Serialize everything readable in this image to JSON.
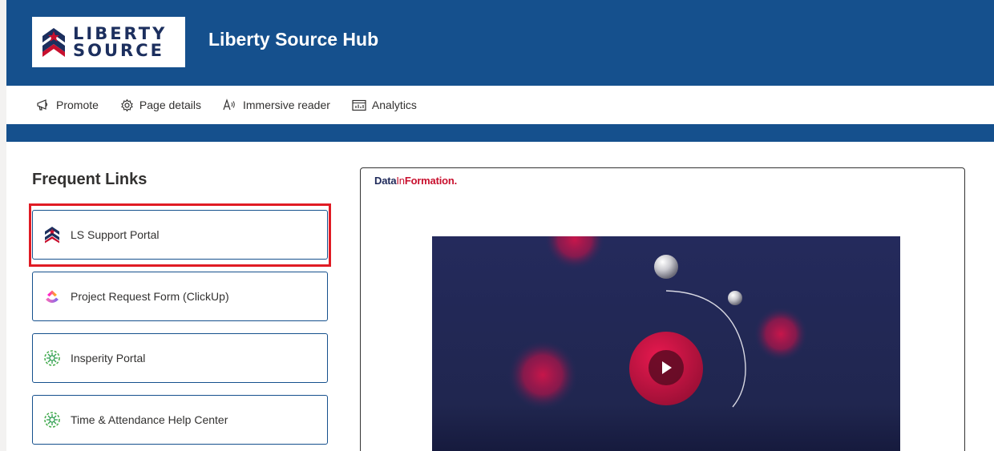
{
  "header": {
    "logo_line1": "LIBERTY",
    "logo_line2": "SOURCE",
    "site_title": "Liberty Source Hub"
  },
  "command_bar": {
    "items": [
      {
        "label": "Promote",
        "icon": "megaphone-icon"
      },
      {
        "label": "Page details",
        "icon": "gear-icon"
      },
      {
        "label": "Immersive reader",
        "icon": "immersive-reader-icon"
      },
      {
        "label": "Analytics",
        "icon": "analytics-icon"
      }
    ]
  },
  "frequent_links": {
    "title": "Frequent Links",
    "items": [
      {
        "label": "LS Support Portal",
        "icon": "liberty-source-icon",
        "highlighted": true
      },
      {
        "label": "Project Request Form (ClickUp)",
        "icon": "clickup-icon"
      },
      {
        "label": "Insperity Portal",
        "icon": "insperity-icon"
      },
      {
        "label": "Time & Attendance Help Center",
        "icon": "insperity-icon"
      }
    ]
  },
  "media": {
    "brand_part1": "Data",
    "brand_part2": "In",
    "brand_part3": "Formation",
    "brand_dot": ".",
    "play_icon": "play-icon"
  },
  "colors": {
    "brand_blue": "#15508d",
    "highlight_red": "#e01b24",
    "video_bg": "#22275a",
    "video_accent": "#c8143c"
  }
}
